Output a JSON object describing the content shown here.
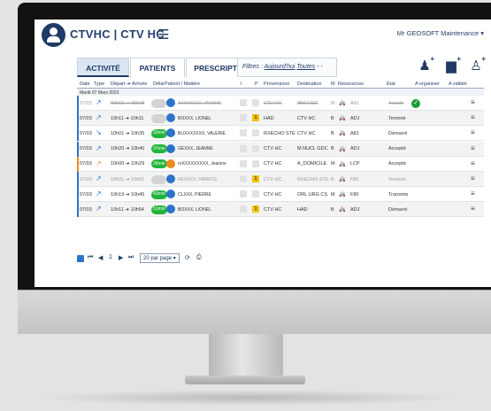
{
  "app": {
    "title": "CTVHC | CTV HC",
    "user": "Mr GEOSOFT Maintenance"
  },
  "tabs": [
    {
      "label": "ACTIVITÉ",
      "active": true
    },
    {
      "label": "PATIENTS",
      "active": false
    },
    {
      "label": "PRESCRIPTIONS",
      "active": false
    }
  ],
  "filters": {
    "label": "Filtres :",
    "value1": "Aujourd'hui",
    "value2": "Toutes",
    "extra": "- -"
  },
  "header_icons": [
    "add-transport-icon",
    "add-building-icon",
    "add-person-icon"
  ],
  "columns": [
    "Date",
    "Type",
    "Départ ➔ Arrivée",
    "Délai",
    "Patient / Matière",
    "I",
    "P",
    "Provenance",
    "Destination",
    "M",
    "Ressources",
    "État",
    "A organiser",
    "A valider"
  ],
  "date_group": "Mardi 07 Mars 2023",
  "rows": [
    {
      "date": "07/03",
      "type": "arrow-blue",
      "time": "09h19 ➔ 09h28",
      "delay": "",
      "patient": "AXXXXXXX, VIVIANE",
      "avatar": "blue",
      "i": "",
      "p": "",
      "provenance": "CTV HC",
      "destination": "IBM GDC",
      "m": "M",
      "ressource": "A81",
      "etat": "Annulé",
      "cancel": true,
      "accent": "#2b74c9"
    },
    {
      "date": "07/03",
      "type": "arrow-blue",
      "time": "10h11 ➔ 10h11",
      "delay": "",
      "patient": "BOXXX, LIONEL",
      "avatar": "blue",
      "i": "",
      "p": "1",
      "provenance": "HAD",
      "destination": "CTV HC",
      "m": "B",
      "ressource": "ADJ",
      "etat": "Terminé",
      "cancel": false,
      "accent": "#2b74c9"
    },
    {
      "date": "07/03",
      "type": "arrow-blue-down",
      "time": "10h01 ➔ 10h35",
      "delay": "33min",
      "patient": "BUXXXXXXX, VALERIE",
      "avatar": "blue",
      "i": "",
      "p": "",
      "provenance": "RXECHO STE",
      "destination": "CTV HC",
      "m": "B",
      "ressource": "A81",
      "etat": "Démarré",
      "cancel": false,
      "accent": "#2b74c9"
    },
    {
      "date": "07/03",
      "type": "arrow-blue",
      "time": "10h20 ➔ 10h40",
      "delay": "37min",
      "patient": "GEXXX, JEANNE",
      "avatar": "blue",
      "i": "",
      "p": "",
      "provenance": "CTV HC",
      "destination": "M.NUCL GDC",
      "m": "B",
      "ressource": "ADJ",
      "etat": "Accepté",
      "cancel": false,
      "accent": "#2b74c9"
    },
    {
      "date": "07/03",
      "type": "arrow-orange",
      "time": "10h00 ➔ 10h29",
      "delay": "26min",
      "patient": "roXXXXXXXXX, Jeanine",
      "avatar": "orange",
      "i": "",
      "p": "",
      "provenance": "CTV HC",
      "destination": "A_DOMICILE",
      "m": "M",
      "ressource": "LCP",
      "etat": "Accepté",
      "cancel": false,
      "accent": "#ef8a1e"
    },
    {
      "date": "07/03",
      "type": "arrow-blue",
      "time": "10h01 ➔ 10h01",
      "delay": "",
      "patient": "REXXXX, FABRICE",
      "avatar": "blue",
      "i": "",
      "p": "1",
      "provenance": "CTV HC",
      "destination": "RXECHO STE",
      "m": "B",
      "ressource": "F80",
      "etat": "Terminé",
      "cancel": false,
      "faded": true,
      "accent": "#2b74c9"
    },
    {
      "date": "07/03",
      "type": "arrow-blue",
      "time": "10h19 ➔ 10h45",
      "delay": "42min",
      "patient": "CLXXX, PIERRE",
      "avatar": "blue",
      "i": "",
      "p": "",
      "provenance": "CTV HC",
      "destination": "ORL URG CS",
      "m": "M",
      "ressource": "F80",
      "etat": "Transmis",
      "cancel": false,
      "accent": "#2b74c9"
    },
    {
      "date": "07/03",
      "type": "arrow-blue",
      "time": "10h11 ➔ 10h54",
      "delay": "51min",
      "patient": "BOXXX, LIONEL",
      "avatar": "blue",
      "i": "",
      "p": "1",
      "provenance": "CTV HC",
      "destination": "HAD",
      "m": "B",
      "ressource": "ADJ",
      "etat": "Démarré",
      "cancel": false,
      "accent": "#2b74c9"
    }
  ],
  "pager": {
    "page": "1",
    "per_page": "20 par page"
  },
  "colors": {
    "brand": "#1f3a66",
    "accent_blue": "#2b74c9",
    "accent_orange": "#ef8a1e",
    "delay_green": "#21b53b",
    "p_yellow": "#f2c200"
  }
}
